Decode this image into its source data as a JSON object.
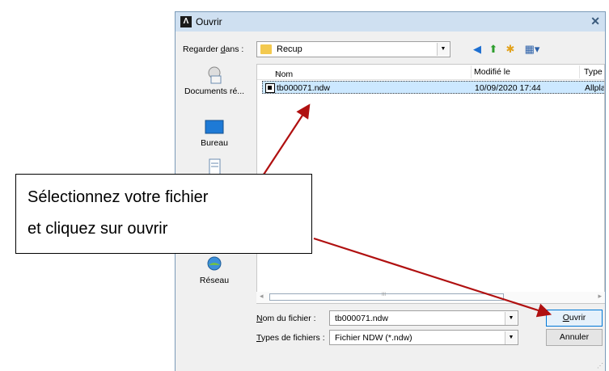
{
  "window": {
    "title": "Ouvrir",
    "close_glyph": "✕"
  },
  "lookin": {
    "label_prefix": "Regarder ",
    "label_accel": "d",
    "label_suffix": "ans :",
    "value": "Recup"
  },
  "places": [
    {
      "label": "Documents ré...",
      "icon": "recent-documents-icon"
    },
    {
      "label": "Bureau",
      "icon": "desktop-icon"
    },
    {
      "label": "",
      "icon": "documents-icon"
    },
    {
      "label": "Réseau",
      "icon": "network-icon"
    }
  ],
  "columns": {
    "name": "Nom",
    "modified": "Modifié le",
    "type": "Type"
  },
  "files": [
    {
      "name": "tb000071.ndw",
      "modified": "10/09/2020 17:44",
      "type": "Allpla"
    }
  ],
  "filename": {
    "label_accel": "N",
    "label_rest": "om du fichier :",
    "value": "tb000071.ndw"
  },
  "filetype": {
    "label_accel": "T",
    "label_rest": "ypes de fichiers :",
    "value": "Fichier NDW (*.ndw)"
  },
  "buttons": {
    "open_accel": "O",
    "open_rest": "uvrir",
    "cancel": "Annuler"
  },
  "callout": {
    "line1": "Sélectionnez votre fichier",
    "line2": "et cliquez sur ouvrir"
  },
  "colors": {
    "arrow": "#b01010",
    "selection": "#cce8ff",
    "titlebar": "#cfe0f1"
  }
}
